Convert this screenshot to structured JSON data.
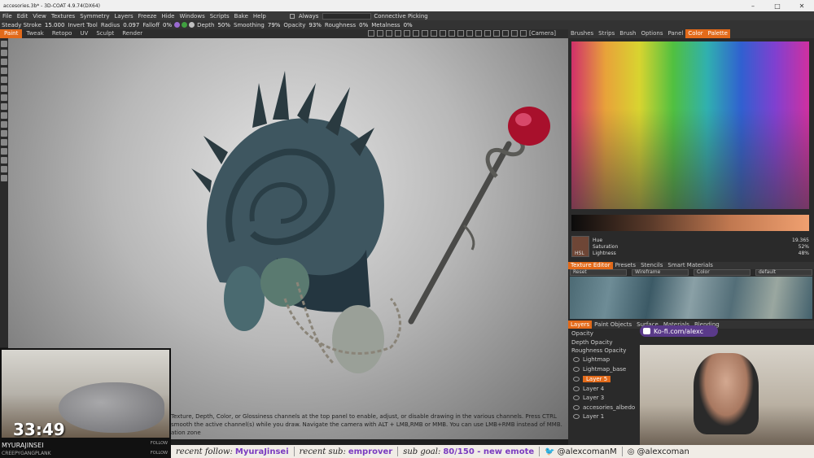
{
  "window": {
    "title": "accesories.3b* - 3D-COAT 4.9.74(DX64)"
  },
  "menu": {
    "items": [
      "File",
      "Edit",
      "View",
      "Textures",
      "Symmetry",
      "Layers",
      "Freeze",
      "Hide",
      "Windows",
      "Scripts",
      "Bake",
      "Help"
    ],
    "always_label": "Always",
    "connective_label": "Connective Picking"
  },
  "toolbar": {
    "stroke_mode": "Steady Stroke",
    "stroke_value": "15.000",
    "invert_label": "Invert Tool",
    "radius_label": "Radius",
    "radius_value": "0.097",
    "falloff_label": "Falloff",
    "falloff_value": "0%",
    "depth_label": "Depth",
    "depth_value": "50%",
    "smoothing_label": "Smoothing",
    "smoothing_value": "79%",
    "opacity_label": "Opacity",
    "opacity_value": "93%",
    "roughness_label": "Roughness",
    "roughness_value": "0%",
    "metalness_label": "Metalness",
    "metalness_value": "0%"
  },
  "rooms": {
    "tabs": [
      "Paint",
      "Tweak",
      "Retopo",
      "UV",
      "Sculpt",
      "Render"
    ],
    "active": "Paint",
    "camera_label": "[Camera]"
  },
  "right_panel": {
    "tabs": [
      "Brushes",
      "Strips",
      "Brush",
      "Options",
      "Panel",
      "Color",
      "Palette"
    ],
    "active_tab": "Color",
    "hsl": {
      "label": "HSL",
      "hue_label": "Hue",
      "hue_value": "19.365",
      "saturation_label": "Saturation",
      "saturation_value": "52%",
      "lightness_label": "Lightness",
      "lightness_value": "48%"
    },
    "sub_tabs": [
      "Texture Editor",
      "Presets",
      "Stencils",
      "Smart Materials"
    ],
    "active_sub_tab": "Texture Editor",
    "texture_editor": {
      "reset": "Reset",
      "wireframe": "Wireframe",
      "channel": "Color",
      "uvset": "default"
    },
    "layer_tabs": [
      "Layers",
      "Paint Objects",
      "Surface",
      "Materials",
      "Blending"
    ],
    "active_layer_tab": "Layers",
    "layer_props": [
      "Opacity",
      "Depth Opacity",
      "Roughness Opacity"
    ],
    "layers": [
      {
        "name": "Lightmap",
        "active": false
      },
      {
        "name": "Lightmap_base",
        "active": false
      },
      {
        "name": "Layer 5",
        "active": true
      },
      {
        "name": "Layer 4",
        "active": false
      },
      {
        "name": "Layer 3",
        "active": false
      },
      {
        "name": "accesories_albedo",
        "active": false
      },
      {
        "name": "Layer 1",
        "active": false
      }
    ]
  },
  "viewport": {
    "hint_text": "Texture, Depth, Color, or Glossiness channels at the top panel to enable, adjust, or disable drawing in the various channels. Press CTRL smooth the active channel(s) while you draw. Navigate the camera with ALT + LMB,RMB or MMB. You can use LMB+RMB instead of MMB. ation zone"
  },
  "stream": {
    "timer": "33:49",
    "viewer_name": "MYURAJINSEI",
    "viewer_sub": "CREEPYGANGPLANK",
    "follow_label": "FOLLOW",
    "kofi": "Ko-fi.com/alexc",
    "ticker": {
      "follow_label": "recent follow:",
      "follow_value": "MyuraJinsei",
      "sub_label": "recent sub:",
      "sub_value": "emprover",
      "goal_label": "sub goal:",
      "goal_value": "80",
      "goal_rest": "/150 - new emote",
      "twitter": "@alexcomanM",
      "instagram": "@alexcoman"
    }
  },
  "colors": {
    "accent": "#e26a1a",
    "kofi": "#5a3a8a"
  }
}
